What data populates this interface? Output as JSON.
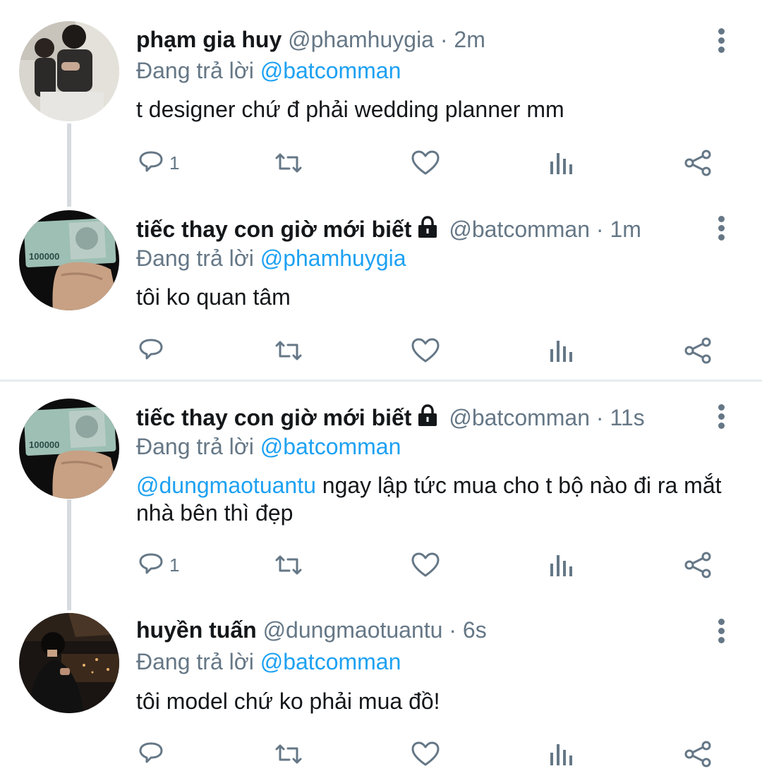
{
  "reply_prefix": "Đang trả lời",
  "tweets": [
    {
      "name": "phạm gia huy",
      "handle": "@phamhuygia",
      "time": "· 2m",
      "reply_to": "@batcomman",
      "mention": "",
      "text": "t designer chứ đ phải wedding planner mm",
      "reply_count": "1",
      "locked": false
    },
    {
      "name": "tiếc thay con giờ mới biết",
      "handle": "@batcomman",
      "time": "· 1m",
      "reply_to": "@phamhuygia",
      "mention": "",
      "text": "tôi ko quan tâm",
      "reply_count": "",
      "locked": true
    },
    {
      "name": "tiếc thay con giờ mới biết",
      "handle": "@batcomman",
      "time": "· 11s",
      "reply_to": "@batcomman",
      "mention": "@dungmaotuantu",
      "text": " ngay lập tức mua cho t bộ nào đi ra mắt nhà bên thì đẹp",
      "reply_count": "1",
      "locked": true
    },
    {
      "name": "huyền tuấn",
      "handle": "@dungmaotuantu",
      "time": "· 6s",
      "reply_to": "@batcomman",
      "mention": "",
      "text": "tôi model chứ ko phải mua đồ!",
      "reply_count": "",
      "locked": false
    }
  ],
  "icons": {
    "reply": "reply-icon",
    "retweet": "retweet-icon",
    "like": "heart-icon",
    "analytics": "analytics-icon",
    "share": "share-icon",
    "more": "more-vertical-icon",
    "lock": "lock-icon"
  },
  "colors": {
    "link": "#1da1f2",
    "secondary": "#657786",
    "thread_line": "#d7dbdf"
  }
}
